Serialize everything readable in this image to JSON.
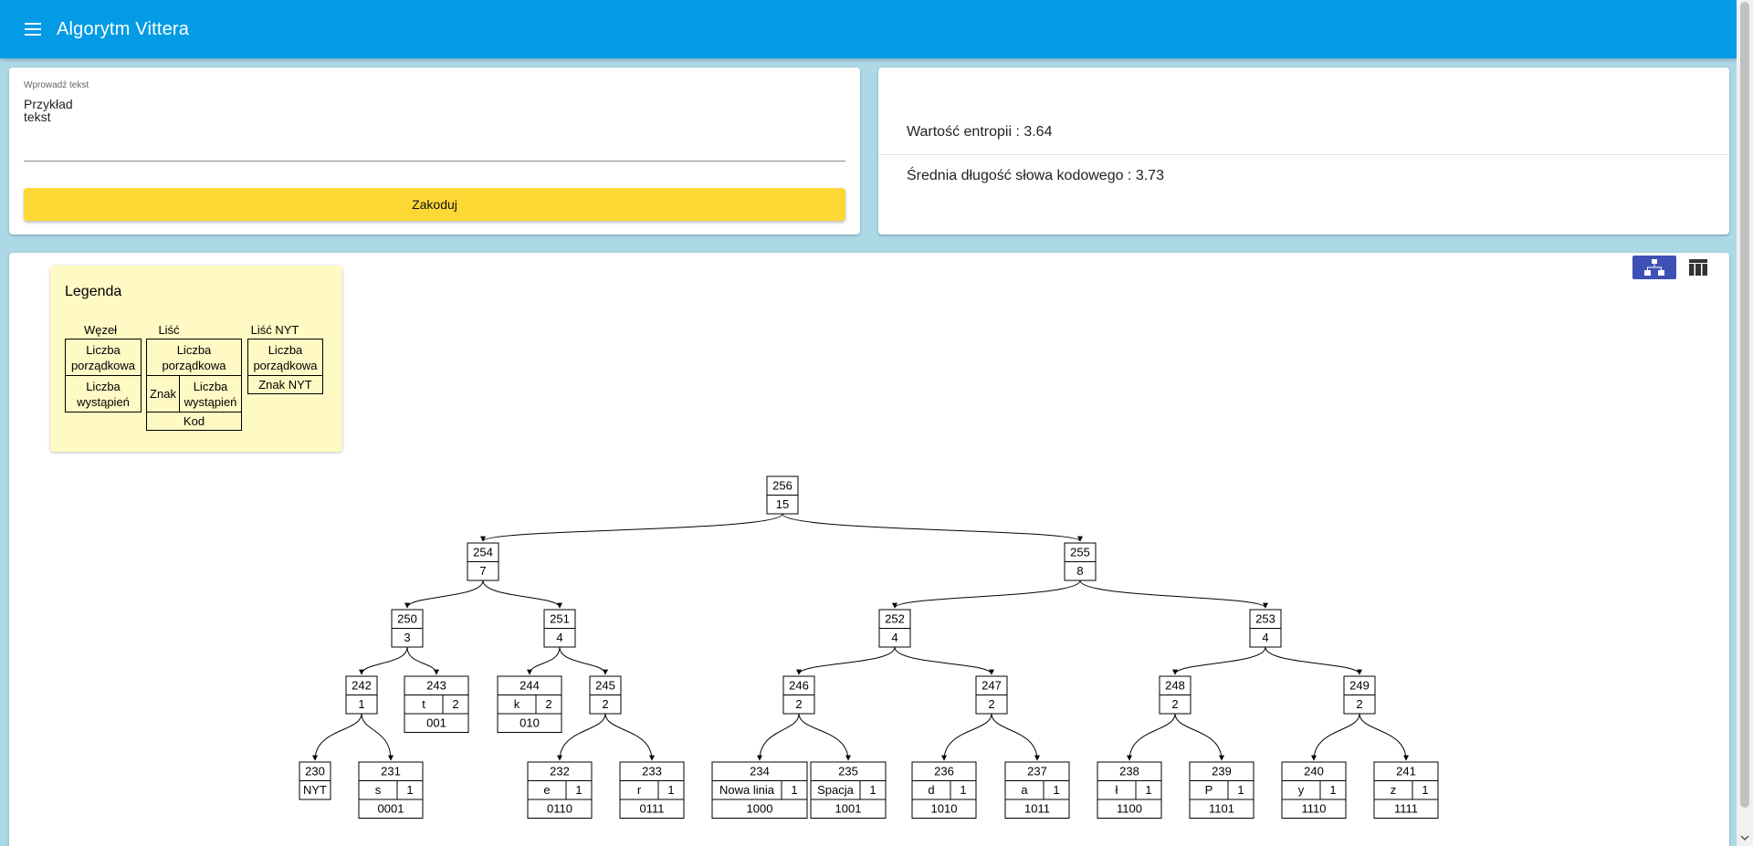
{
  "app": {
    "title": "Algorytm Vittera"
  },
  "input": {
    "label": "Wprowadź tekst",
    "value": "Przykład\ntekst",
    "button_label": "Zakoduj"
  },
  "stats": {
    "entropy": "Wartość entropii : 3.64",
    "avg_length": "Średnia długość słowa kodowego : 3.73"
  },
  "legend": {
    "title": "Legenda",
    "node_head": "Węzeł",
    "leaf_head": "Liść",
    "nyt_head": "Liść NYT",
    "order_number": "Liczba porządkowa",
    "occurrences": "Liczba wystąpień",
    "symbol": "Znak",
    "code": "Kod",
    "nyt_symbol": "Znak NYT"
  },
  "tree": {
    "nodes": [
      {
        "id": 256,
        "type": "node",
        "weight": 15,
        "parent": null
      },
      {
        "id": 254,
        "type": "node",
        "weight": 7,
        "parent": 256
      },
      {
        "id": 255,
        "type": "node",
        "weight": 8,
        "parent": 256
      },
      {
        "id": 250,
        "type": "node",
        "weight": 3,
        "parent": 254
      },
      {
        "id": 251,
        "type": "node",
        "weight": 4,
        "parent": 254
      },
      {
        "id": 252,
        "type": "node",
        "weight": 4,
        "parent": 255
      },
      {
        "id": 253,
        "type": "node",
        "weight": 4,
        "parent": 255
      },
      {
        "id": 242,
        "type": "node",
        "weight": 1,
        "parent": 250
      },
      {
        "id": 243,
        "type": "leaf",
        "symbol": "t",
        "weight": 2,
        "code": "001",
        "parent": 250
      },
      {
        "id": 244,
        "type": "leaf",
        "symbol": "k",
        "weight": 2,
        "code": "010",
        "parent": 251
      },
      {
        "id": 245,
        "type": "node",
        "weight": 2,
        "parent": 251
      },
      {
        "id": 246,
        "type": "node",
        "weight": 2,
        "parent": 252
      },
      {
        "id": 247,
        "type": "node",
        "weight": 2,
        "parent": 252
      },
      {
        "id": 248,
        "type": "node",
        "weight": 2,
        "parent": 253
      },
      {
        "id": 249,
        "type": "node",
        "weight": 2,
        "parent": 253
      },
      {
        "id": 230,
        "type": "nyt",
        "symbol": "NYT",
        "parent": 242
      },
      {
        "id": 231,
        "type": "leaf",
        "symbol": "s",
        "weight": 1,
        "code": "0001",
        "parent": 242
      },
      {
        "id": 232,
        "type": "leaf",
        "symbol": "e",
        "weight": 1,
        "code": "0110",
        "parent": 245
      },
      {
        "id": 233,
        "type": "leaf",
        "symbol": "r",
        "weight": 1,
        "code": "0111",
        "parent": 245
      },
      {
        "id": 234,
        "type": "leaf",
        "symbol": "Nowa linia",
        "weight": 1,
        "code": "1000",
        "parent": 246
      },
      {
        "id": 235,
        "type": "leaf",
        "symbol": "Spacja",
        "weight": 1,
        "code": "1001",
        "parent": 246
      },
      {
        "id": 236,
        "type": "leaf",
        "symbol": "d",
        "weight": 1,
        "code": "1010",
        "parent": 247
      },
      {
        "id": 237,
        "type": "leaf",
        "symbol": "a",
        "weight": 1,
        "code": "1011",
        "parent": 247
      },
      {
        "id": 238,
        "type": "leaf",
        "symbol": "ł",
        "weight": 1,
        "code": "1100",
        "parent": 248
      },
      {
        "id": 239,
        "type": "leaf",
        "symbol": "P",
        "weight": 1,
        "code": "1101",
        "parent": 248
      },
      {
        "id": 240,
        "type": "leaf",
        "symbol": "y",
        "weight": 1,
        "code": "1110",
        "parent": 249
      },
      {
        "id": 241,
        "type": "leaf",
        "symbol": "z",
        "weight": 1,
        "code": "1111",
        "parent": 249
      }
    ]
  },
  "colors": {
    "appbar": "#039be5",
    "background": "#add8e6",
    "encode_button": "#fdd835",
    "legend_bg": "#fff9c4",
    "toggle_active": "#3f51b5"
  },
  "icons": {
    "menu": "menu-icon",
    "tree_view": "tree-view-icon",
    "table_view": "table-view-icon"
  }
}
